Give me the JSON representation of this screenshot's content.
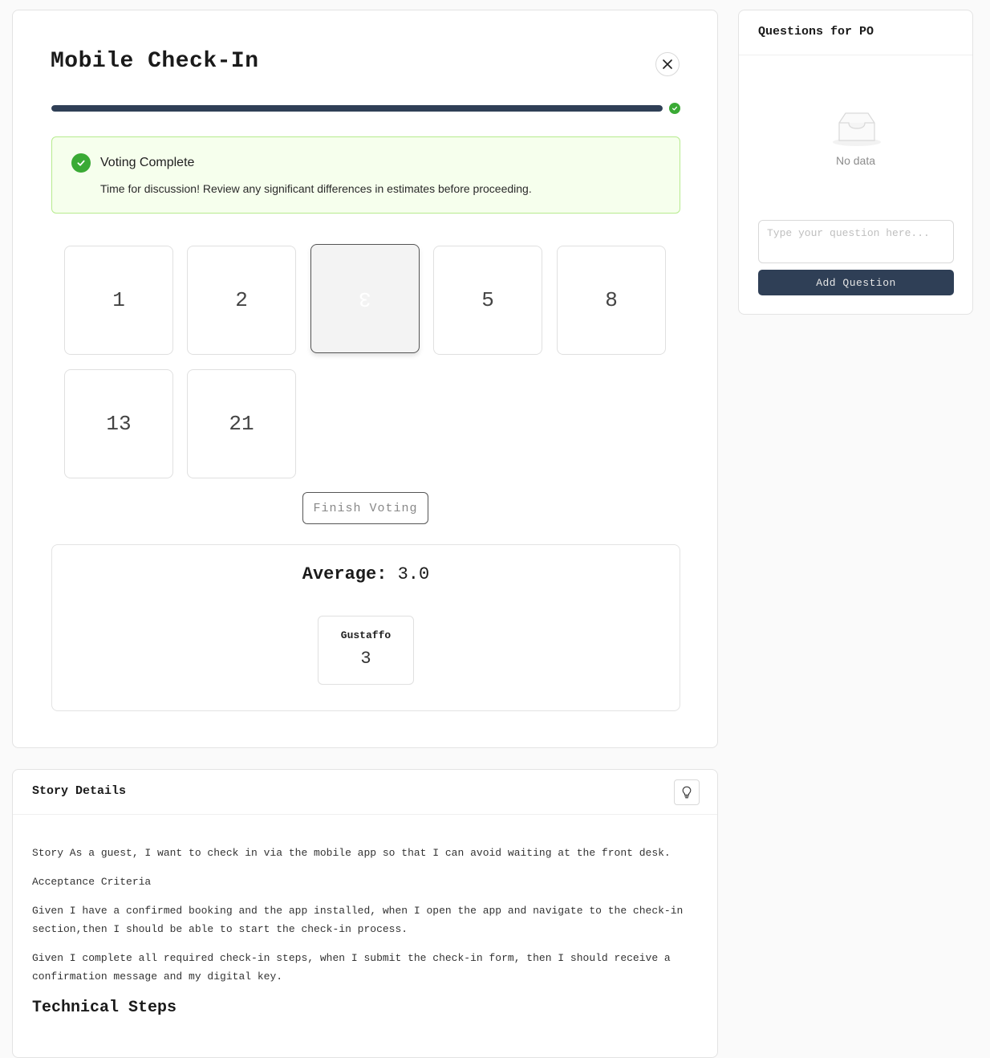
{
  "session": {
    "title": "Mobile Check-In",
    "progress_fraction": 1.0
  },
  "alert": {
    "title": "Voting Complete",
    "description": "Time for discussion! Review any significant differences in estimates before proceeding."
  },
  "cards": [
    "1",
    "2",
    "3",
    "5",
    "8",
    "13",
    "21"
  ],
  "selected_card": "3",
  "finish_label": "Finish Voting",
  "results": {
    "average_label": "Average:",
    "average_value": "3.0",
    "votes": [
      {
        "name": "Gustaffo",
        "value": "3"
      }
    ]
  },
  "story": {
    "header": "Story Details",
    "paragraphs": [
      "Story As a guest, I want to check in via the mobile app so that I can avoid waiting at the front desk.",
      "Acceptance Criteria",
      "Given I have a confirmed booking and the app installed, when I open the app and navigate to the check-in section,then I should be able to start the check-in process.",
      "Given I complete all required check-in steps, when I submit the check-in form, then I should receive a confirmation message and my digital key."
    ],
    "subheading": "Technical Steps"
  },
  "questions": {
    "header": "Questions for PO",
    "empty_text": "No data",
    "input_placeholder": "Type your question here...",
    "input_value": "",
    "add_label": "Add Question"
  },
  "colors": {
    "primary": "#2f3f56",
    "success": "#3aaa35",
    "alert_bg": "#f6ffed",
    "alert_border": "#b7eb8f"
  },
  "icons": {
    "close": "close-icon",
    "progress_done": "check-circle-icon",
    "alert": "check-circle-icon",
    "story_action": "lightbulb-icon",
    "empty": "inbox-icon"
  }
}
